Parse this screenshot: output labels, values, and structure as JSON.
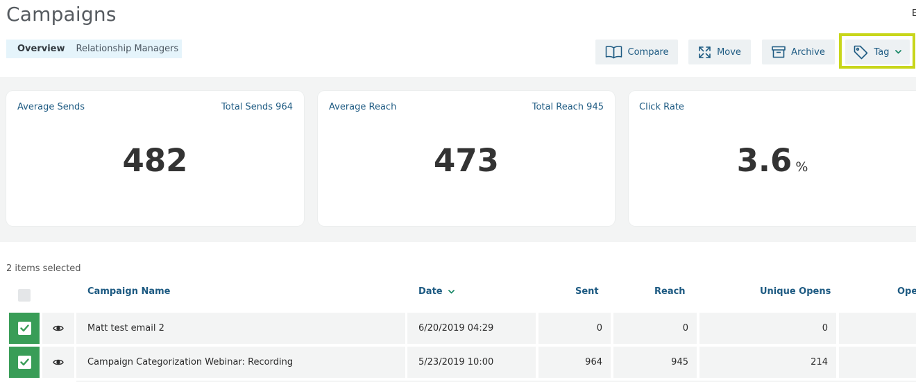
{
  "page": {
    "title": "Campaigns",
    "corner_letter": "E"
  },
  "tabs": [
    {
      "label": "Overview",
      "active": true
    },
    {
      "label": "Relationship Managers",
      "active": false
    }
  ],
  "toolbar": {
    "compare_label": "Compare",
    "move_label": "Move",
    "archive_label": "Archive",
    "tag_label": "Tag"
  },
  "stats": {
    "sends": {
      "label": "Average Sends",
      "total_label": "Total Sends 964",
      "value": "482"
    },
    "reach": {
      "label": "Average Reach",
      "total_label": "Total Reach 945",
      "value": "473"
    },
    "click": {
      "label": "Click Rate",
      "value": "3.6",
      "unit": "%"
    }
  },
  "table": {
    "selected_text": "2 items selected",
    "columns": {
      "name": "Campaign Name",
      "date": "Date",
      "sent": "Sent",
      "reach": "Reach",
      "unique_opens": "Unique Opens",
      "opens": "Oper"
    },
    "rows": [
      {
        "name": "Matt test email 2",
        "date": "6/20/2019 04:29",
        "sent": "0",
        "reach": "0",
        "unique_opens": "0",
        "checked": true
      },
      {
        "name": "Campaign Categorization Webinar: Recording",
        "date": "5/23/2019 10:00",
        "sent": "964",
        "reach": "945",
        "unique_opens": "214",
        "checked": true
      }
    ]
  },
  "colors": {
    "accent": "#1d5a82",
    "highlight": "#c8d61b",
    "checked": "#399d57"
  },
  "icons": {
    "compare": "open-book-icon",
    "move": "arrows-expand-icon",
    "archive": "archive-box-icon",
    "tag": "tag-icon",
    "dropdown": "chevron-down-icon",
    "sort": "chevron-down-icon",
    "preview": "eye-icon",
    "checked": "checkmark-icon"
  }
}
